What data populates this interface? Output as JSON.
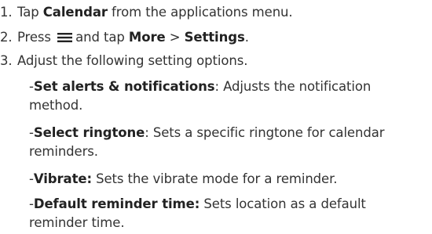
{
  "steps": [
    {
      "num": "1.",
      "pre": "Tap ",
      "bold": "Calendar",
      "post": " from the applications menu."
    },
    {
      "num": "2.",
      "pre": "Press",
      "post_icon": "and tap ",
      "bold1": "More",
      "sep": " > ",
      "bold2": "Settings",
      "end": ".",
      "icon": "menu-icon"
    },
    {
      "num": "3.",
      "text": "Adjust the following setting options."
    }
  ],
  "options": [
    {
      "name": "Set alerts & notifications",
      "sep": ": ",
      "desc": "Adjusts the notification method."
    },
    {
      "name": "Select ringtone",
      "sep": ": ",
      "desc": "Sets a specific ringtone for calendar reminders."
    },
    {
      "name": "Vibrate:",
      "sep": " ",
      "desc": "Sets the vibrate mode for a reminder."
    },
    {
      "name": "Default reminder time:",
      "sep": " ",
      "desc": "Sets location as a default reminder time."
    }
  ],
  "dash": "-",
  "colors": {
    "text": "#333333",
    "bold": "#222222"
  }
}
